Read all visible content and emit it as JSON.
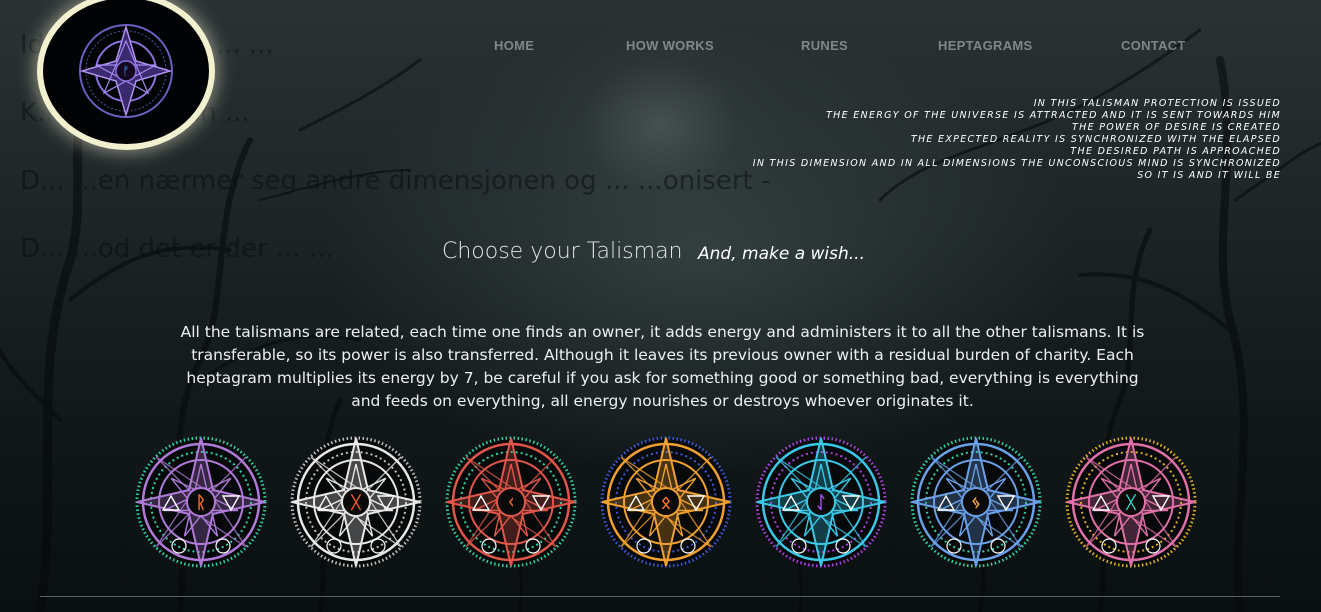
{
  "ghost_text": [
    "Ide... ...anen... ... ...",
    "K... ...er skaten ...",
    "D... ...en nærmer seg andre dimensjonen og ... ...onisert -",
    "D... ...od det er der ... ..."
  ],
  "logo": {
    "icon": "heptagram-talisman-icon",
    "accent": "#9b7fe0"
  },
  "nav": {
    "items": [
      {
        "label": "HOME"
      },
      {
        "label": "HOW WORKS"
      },
      {
        "label": "RUNES"
      },
      {
        "label": "HEPTAGRAMS"
      },
      {
        "label": "CONTACT"
      }
    ]
  },
  "invocation": [
    "IN THIS TALISMAN PROTECTION IS ISSUED",
    "THE ENERGY OF THE UNIVERSE IS ATTRACTED AND IT IS SENT TOWARDS HIM",
    "THE POWER OF DESIRE IS CREATED",
    "THE EXPECTED REALITY IS SYNCHRONIZED WITH THE ELAPSED",
    "THE DESIRED PATH IS APPROACHED",
    "IN THIS DIMENSION AND IN ALL DIMENSIONS THE UNCONSCIOUS MIND IS SYNCHRONIZED",
    "SO IT IS AND IT WILL BE"
  ],
  "choose": {
    "title": "Choose your Talisman",
    "subtitle": "And, make a wish..."
  },
  "description": "All the talismans are related, each time one finds an owner, it adds energy and administers it to all the other talismans. It is transferable, so its power is also transferred. Although it leaves its previous owner with a residual burden of charity. Each heptagram multiplies its energy by 7, be careful if you ask for something good or something bad, everything is everything and feeds on everything, all energy nourishes or destroys whoever originates it.",
  "talismans": [
    {
      "name": "talisman-violet",
      "primary": "#b07ad8",
      "ring": "#2fd0a8",
      "rune": "#ff6a2a",
      "rune_glyph": "ᚱ"
    },
    {
      "name": "talisman-silver",
      "primary": "#e8e8e8",
      "ring": "#bfbfbf",
      "rune": "#ff5a2a",
      "rune_glyph": "ᚷ"
    },
    {
      "name": "talisman-red",
      "primary": "#e0564a",
      "ring": "#2fd0a8",
      "rune": "#ff6a2a",
      "rune_glyph": "ᚲ"
    },
    {
      "name": "talisman-orange",
      "primary": "#f0a030",
      "ring": "#3a5ad8",
      "rune": "#ff7a2a",
      "rune_glyph": "ᛟ"
    },
    {
      "name": "talisman-cyan",
      "primary": "#3ac8e8",
      "ring": "#b040e0",
      "rune": "#b050ff",
      "rune_glyph": "ᛇ"
    },
    {
      "name": "talisman-blue",
      "primary": "#6aa0e8",
      "ring": "#2fd0a8",
      "rune": "#ffb030",
      "rune_glyph": "ᛃ"
    },
    {
      "name": "talisman-pink",
      "primary": "#e070a8",
      "ring": "#e0b020",
      "rune": "#30d8c8",
      "rune_glyph": "ᚷ"
    }
  ]
}
